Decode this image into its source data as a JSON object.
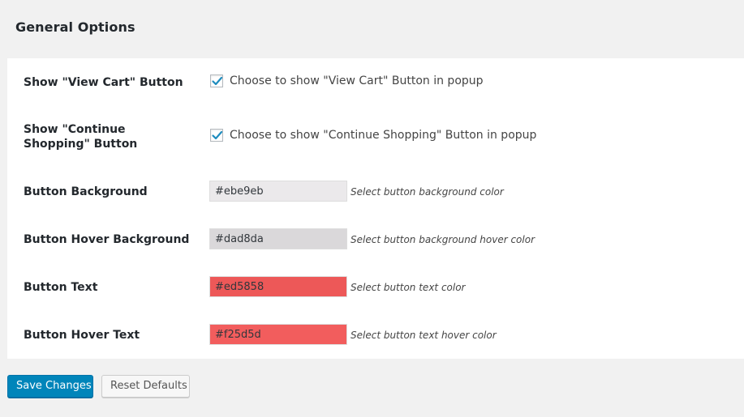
{
  "section": {
    "title": "General Options"
  },
  "options": {
    "view_cart": {
      "label": "Show \"View Cart\" Button",
      "checked": true,
      "description": "Choose to show \"View Cart\" Button in popup"
    },
    "continue_shopping": {
      "label": "Show \"Continue Shopping\" Button",
      "checked": true,
      "description": "Choose to show \"Continue Shopping\" Button in popup"
    },
    "button_background": {
      "label": "Button Background",
      "value": "#ebe9eb",
      "description": "Select button background color",
      "swatch": "#ebe9eb"
    },
    "button_hover_background": {
      "label": "Button Hover Background",
      "value": "#dad8da",
      "description": "Select button background hover color",
      "swatch": "#dad8da"
    },
    "button_text": {
      "label": "Button Text",
      "value": "#ed5858",
      "description": "Select button text color",
      "swatch": "#ed5858"
    },
    "button_hover_text": {
      "label": "Button Hover Text",
      "value": "#f25d5d",
      "description": "Select button text hover color",
      "swatch": "#f25d5d"
    }
  },
  "actions": {
    "save_label": "Save Changes",
    "reset_label": "Reset Defaults"
  },
  "colors": {
    "primary_button": "#0085ba",
    "checkmark": "#1e8cbe",
    "page_background": "#f1f1f1",
    "panel_background": "#ffffff"
  }
}
